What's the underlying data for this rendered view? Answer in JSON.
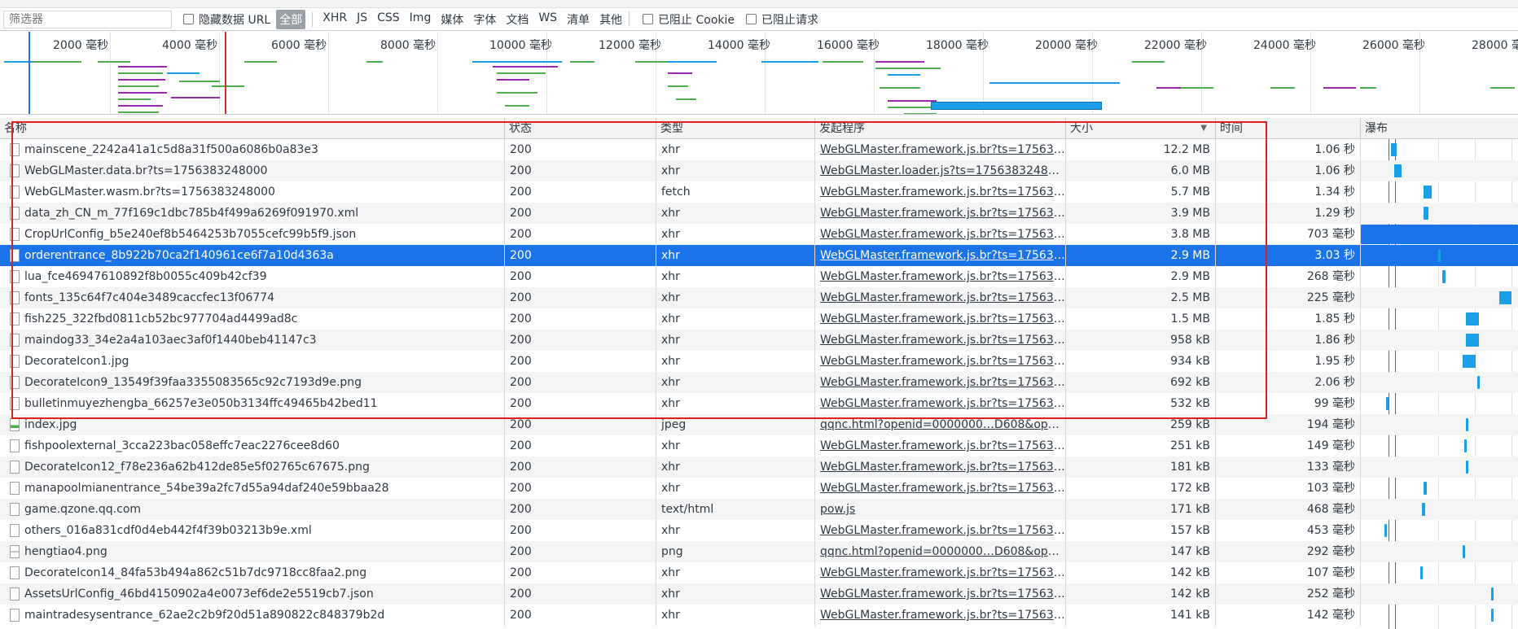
{
  "toolbar": {
    "filter_placeholder": "筛选器",
    "hide_data_url": "隐藏数据 URL",
    "type_all": "全部",
    "types": [
      "XHR",
      "JS",
      "CSS",
      "Img",
      "媒体",
      "字体",
      "文档",
      "WS",
      "清单",
      "其他"
    ],
    "blocked_cookies": "已阻止 Cookie",
    "blocked_requests": "已阻止请求"
  },
  "overview": {
    "tick_labels": [
      "2000 毫秒",
      "4000 毫秒",
      "6000 毫秒",
      "8000 毫秒",
      "10000 毫秒",
      "12000 毫秒",
      "14000 毫秒",
      "16000 毫秒",
      "18000 毫秒",
      "20000 毫秒",
      "22000 毫秒",
      "24000 毫秒",
      "26000 毫秒",
      "28000 毫秒"
    ]
  },
  "columns": {
    "name": "名称",
    "status": "状态",
    "type": "类型",
    "initiator": "发起程序",
    "size": "大小",
    "time": "时间",
    "waterfall": "瀑布"
  },
  "rows": [
    {
      "name": "mainscene_2242a41a1c5d8a31f500a6086b0a83e3",
      "status": "200",
      "type": "xhr",
      "initiator": "WebGLMaster.framework.js.br?ts=1756383…",
      "size": "12.2 MB",
      "time": "1.06 秒",
      "icon": "file-icon",
      "wf_start": 0.19,
      "wf_len": 0.04
    },
    {
      "name": "WebGLMaster.data.br?ts=1756383248000",
      "status": "200",
      "type": "xhr",
      "initiator": "WebGLMaster.loader.js?ts=1756383248000:1",
      "size": "6.0 MB",
      "time": "1.06 秒",
      "icon": "file-icon",
      "wf_start": 0.21,
      "wf_len": 0.05
    },
    {
      "name": "WebGLMaster.wasm.br?ts=1756383248000",
      "status": "200",
      "type": "fetch",
      "initiator": "WebGLMaster.framework.js.br?ts=1756383…",
      "size": "5.7 MB",
      "time": "1.34 秒",
      "icon": "file-icon",
      "wf_start": 0.4,
      "wf_len": 0.05
    },
    {
      "name": "data_zh_CN_m_77f169c1dbc785b4f499a6269f091970.xml",
      "status": "200",
      "type": "xhr",
      "initiator": "WebGLMaster.framework.js.br?ts=1756383…",
      "size": "3.9 MB",
      "time": "1.29 秒",
      "icon": "file-icon",
      "wf_start": 0.4,
      "wf_len": 0.03
    },
    {
      "name": "CropUrlConfig_b5e240ef8b5464253b7055cefc99b5f9.json",
      "status": "200",
      "type": "xhr",
      "initiator": "WebGLMaster.framework.js.br?ts=1756383…",
      "size": "3.8 MB",
      "time": "703 毫秒",
      "icon": "file-icon",
      "wf_start": 0.0,
      "wf_len": 1.0
    },
    {
      "name": "orderentrance_8b922b70ca2f140961ce6f7a10d4363a",
      "status": "200",
      "type": "xhr",
      "initiator": "WebGLMaster.framework.js.br?ts=1756383…",
      "size": "2.9 MB",
      "time": "3.03 秒",
      "icon": "file-icon",
      "wf_start": 0.49,
      "wf_len": 0.02
    },
    {
      "name": "lua_fce46947610892f8b0055c409b42cf39",
      "status": "200",
      "type": "xhr",
      "initiator": "WebGLMaster.framework.js.br?ts=1756383…",
      "size": "2.9 MB",
      "time": "268 毫秒",
      "icon": "file-icon",
      "wf_start": 0.52,
      "wf_len": 0.02
    },
    {
      "name": "fonts_135c64f7c404e3489caccfec13f06774",
      "status": "200",
      "type": "xhr",
      "initiator": "WebGLMaster.framework.js.br?ts=1756383…",
      "size": "2.5 MB",
      "time": "225 毫秒",
      "icon": "file-icon",
      "wf_start": 0.88,
      "wf_len": 0.08
    },
    {
      "name": "fish225_322fbd0811cb52bc977704ad4499ad8c",
      "status": "200",
      "type": "xhr",
      "initiator": "WebGLMaster.framework.js.br?ts=1756383…",
      "size": "1.5 MB",
      "time": "1.85 秒",
      "icon": "file-icon",
      "wf_start": 0.67,
      "wf_len": 0.08
    },
    {
      "name": "maindog33_34e2a4a103aec3af0f1440beb41147c3",
      "status": "200",
      "type": "xhr",
      "initiator": "WebGLMaster.framework.js.br?ts=1756383…",
      "size": "958 kB",
      "time": "1.86 秒",
      "icon": "file-icon",
      "wf_start": 0.67,
      "wf_len": 0.08
    },
    {
      "name": "DecorateIcon1.jpg",
      "status": "200",
      "type": "xhr",
      "initiator": "WebGLMaster.framework.js.br?ts=1756383…",
      "size": "934 kB",
      "time": "1.95 秒",
      "icon": "file-icon",
      "wf_start": 0.65,
      "wf_len": 0.08
    },
    {
      "name": "DecorateIcon9_13549f39faa3355083565c92c7193d9e.png",
      "status": "200",
      "type": "xhr",
      "initiator": "WebGLMaster.framework.js.br?ts=1756383…",
      "size": "692 kB",
      "time": "2.06 秒",
      "icon": "file-icon",
      "wf_start": 0.74,
      "wf_len": 0.01
    },
    {
      "name": "bulletinmuyezhengba_66257e3e050b3134ffc49465b42bed11",
      "status": "200",
      "type": "xhr",
      "initiator": "WebGLMaster.framework.js.br?ts=1756383…",
      "size": "532 kB",
      "time": "99 毫秒",
      "icon": "file-icon",
      "wf_start": 0.16,
      "wf_len": 0.01
    },
    {
      "name": "index.jpg",
      "status": "200",
      "type": "jpeg",
      "initiator": "qqnc.html?openid=0000000…D608&openk…",
      "size": "259 kB",
      "time": "194 毫秒",
      "icon": "image-icon",
      "wf_start": 0.67,
      "wf_len": 0.01
    },
    {
      "name": "fishpoolexternal_3cca223bac058effc7eac2276cee8d60",
      "status": "200",
      "type": "xhr",
      "initiator": "WebGLMaster.framework.js.br?ts=1756383…",
      "size": "251 kB",
      "time": "149 毫秒",
      "icon": "file-icon",
      "wf_start": 0.66,
      "wf_len": 0.01
    },
    {
      "name": "DecorateIcon12_f78e236a62b412de85e5f02765c67675.png",
      "status": "200",
      "type": "xhr",
      "initiator": "WebGLMaster.framework.js.br?ts=1756383…",
      "size": "181 kB",
      "time": "133 毫秒",
      "icon": "file-icon",
      "wf_start": 0.67,
      "wf_len": 0.01
    },
    {
      "name": "manapoolmianentrance_54be39a2fc7d55a94daf240e59bbaa28",
      "status": "200",
      "type": "xhr",
      "initiator": "WebGLMaster.framework.js.br?ts=1756383…",
      "size": "172 kB",
      "time": "103 毫秒",
      "icon": "file-icon",
      "wf_start": 0.4,
      "wf_len": 0.02
    },
    {
      "name": "game.qzone.qq.com",
      "status": "200",
      "type": "text/html",
      "initiator": "pow.js",
      "size": "171 kB",
      "time": "468 毫秒",
      "icon": "file-icon",
      "wf_start": 0.39,
      "wf_len": 0.02
    },
    {
      "name": "others_016a831cdf0d4eb442f4f39b03213b9e.xml",
      "status": "200",
      "type": "xhr",
      "initiator": "WebGLMaster.framework.js.br?ts=1756383…",
      "size": "157 kB",
      "time": "453 毫秒",
      "icon": "file-icon",
      "wf_start": 0.15,
      "wf_len": 0.01
    },
    {
      "name": "hengtiao4.png",
      "status": "200",
      "type": "png",
      "initiator": "qqnc.html?openid=0000000…D608&openk…",
      "size": "147 kB",
      "time": "292 毫秒",
      "icon": "dash-icon",
      "wf_start": 0.65,
      "wf_len": 0.01
    },
    {
      "name": "DecorateIcon14_84fa53b494a862c51b7dc9718cc8faa2.png",
      "status": "200",
      "type": "xhr",
      "initiator": "WebGLMaster.framework.js.br?ts=1756383…",
      "size": "142 kB",
      "time": "107 毫秒",
      "icon": "file-icon",
      "wf_start": 0.38,
      "wf_len": 0.01
    },
    {
      "name": "AssetsUrlConfig_46bd4150902a4e0073ef6de2e5519cb7.json",
      "status": "200",
      "type": "xhr",
      "initiator": "WebGLMaster.framework.js.br?ts=1756383…",
      "size": "142 kB",
      "time": "252 毫秒",
      "icon": "file-icon",
      "wf_start": 0.83,
      "wf_len": 0.01
    },
    {
      "name": "maintradesysentrance_62ae2c2b9f20d51a890822c848379b2d",
      "status": "200",
      "type": "xhr",
      "initiator": "WebGLMaster.framework.js.br?ts=1756383…",
      "size": "141 kB",
      "time": "142 毫秒",
      "icon": "file-icon",
      "wf_start": 0.83,
      "wf_len": 0.01
    }
  ],
  "selected_index": 5,
  "colors": {
    "selected_row": "#1a73e8",
    "waterfall_bar": "#1aa0e8",
    "highlight_box": "#e02020",
    "load_marker": "#1a73e8",
    "dom_marker": "#d32f2f"
  }
}
